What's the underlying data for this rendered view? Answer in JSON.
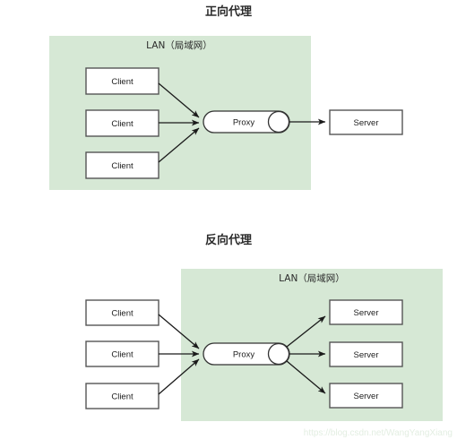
{
  "page": {
    "background": "#ffffff",
    "watermark": "https://blog.csdn.net/WangYangXiang"
  },
  "colors": {
    "lan_panel": "#d6e8d5",
    "node_fill": "#ffffff",
    "node_stroke": "#555555",
    "edge": "#1a1a1a",
    "text": "#222222",
    "watermark": "#e3eee2"
  },
  "sections": [
    {
      "id": "forward-proxy",
      "title": "正向代理",
      "lan_label": "LAN（局域网）",
      "lan_contains": [
        "clients",
        "proxy"
      ],
      "clients": [
        {
          "label": "Client"
        },
        {
          "label": "Client"
        },
        {
          "label": "Client"
        }
      ],
      "proxy": {
        "label": "Proxy"
      },
      "servers": [
        {
          "label": "Server"
        }
      ]
    },
    {
      "id": "reverse-proxy",
      "title": "反向代理",
      "lan_label": "LAN（局域网）",
      "lan_contains": [
        "proxy",
        "servers"
      ],
      "clients": [
        {
          "label": "Client"
        },
        {
          "label": "Client"
        },
        {
          "label": "Client"
        }
      ],
      "proxy": {
        "label": "Proxy"
      },
      "servers": [
        {
          "label": "Server"
        },
        {
          "label": "Server"
        },
        {
          "label": "Server"
        }
      ]
    }
  ]
}
